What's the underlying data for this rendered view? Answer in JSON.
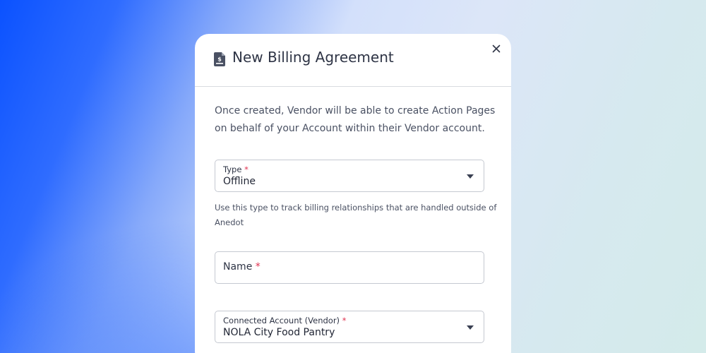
{
  "modal": {
    "title": "New Billing Agreement",
    "header_icon": "invoice-dollar-icon",
    "close_icon": "close-icon",
    "description": "Once created, Vendor will be able to create Action Pages on behalf of your Account within their Vendor account."
  },
  "fields": {
    "type": {
      "label": "Type",
      "required_mark": "*",
      "value": "Offline",
      "helper": "Use this type to track billing relationships that are handled outside of Anedot"
    },
    "name": {
      "label": "Name",
      "required_mark": "*"
    },
    "connected_account": {
      "label": "Connected Account (Vendor)",
      "required_mark": "*",
      "value": "NOLA City Food Pantry"
    }
  },
  "colors": {
    "required": "#e0314f",
    "text": "#2e3445",
    "border": "#c5c9d1",
    "accent_blue": "#0b52ff"
  }
}
